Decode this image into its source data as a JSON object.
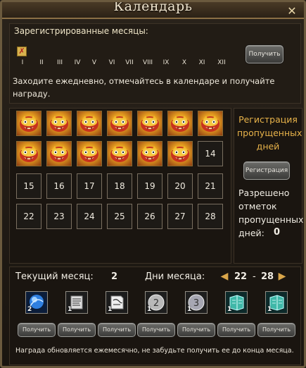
{
  "window": {
    "title": "Календарь",
    "close_glyph": "✕"
  },
  "top": {
    "registered_months_title": "Зарегистрированные месяцы:",
    "mark_icon": "calendar-mark-icon",
    "months": [
      "I",
      "II",
      "III",
      "IV",
      "V",
      "VI",
      "VII",
      "VIII",
      "IX",
      "X",
      "XI",
      "XII"
    ],
    "claim_label": "Получить",
    "info_text": "Заходите ежедневно, отмечайтесь в календаре и получайте награду."
  },
  "calendar": {
    "claimed_icon": "tiger-reward-icon",
    "days": [
      {
        "label": "",
        "claimed": true
      },
      {
        "label": "",
        "claimed": true
      },
      {
        "label": "",
        "claimed": true
      },
      {
        "label": "",
        "claimed": true
      },
      {
        "label": "",
        "claimed": true
      },
      {
        "label": "",
        "claimed": true
      },
      {
        "label": "",
        "claimed": true
      },
      {
        "label": "",
        "claimed": true
      },
      {
        "label": "",
        "claimed": true
      },
      {
        "label": "",
        "claimed": true
      },
      {
        "label": "",
        "claimed": true
      },
      {
        "label": "",
        "claimed": true
      },
      {
        "label": "",
        "claimed": true
      },
      {
        "label": "14",
        "claimed": false
      },
      {
        "label": "15",
        "claimed": false
      },
      {
        "label": "16",
        "claimed": false
      },
      {
        "label": "17",
        "claimed": false
      },
      {
        "label": "18",
        "claimed": false
      },
      {
        "label": "19",
        "claimed": false
      },
      {
        "label": "20",
        "claimed": false
      },
      {
        "label": "21",
        "claimed": false
      },
      {
        "label": "22",
        "claimed": false
      },
      {
        "label": "23",
        "claimed": false
      },
      {
        "label": "24",
        "claimed": false
      },
      {
        "label": "25",
        "claimed": false
      },
      {
        "label": "26",
        "claimed": false
      },
      {
        "label": "27",
        "claimed": false
      },
      {
        "label": "28",
        "claimed": false
      }
    ]
  },
  "side": {
    "missed_title": "Регистрация пропущенных дней",
    "register_label": "Регистрация",
    "allowed_text": "Разрешено отметок пропущенных дней:",
    "allowed_count": "0"
  },
  "bottom": {
    "current_month_label": "Текущий месяц:",
    "current_month_value": "2",
    "days_label": "Дни месяца:",
    "range_from": "22",
    "range_sep": "-",
    "range_to": "28",
    "arrow_left": "◀",
    "arrow_right": "▶",
    "rewards": [
      {
        "icon": "blue-orb-icon",
        "count": "2",
        "claim_label": "Получить"
      },
      {
        "icon": "scroll-icon",
        "count": "1",
        "claim_label": "Получить"
      },
      {
        "icon": "paper-note-icon",
        "count": "1",
        "claim_label": "Получить"
      },
      {
        "icon": "silver-coin-2-icon",
        "count": "1",
        "claim_label": "Получить"
      },
      {
        "icon": "silver-coin-3-icon",
        "count": "1",
        "claim_label": "Получить"
      },
      {
        "icon": "teal-book-icon",
        "count": "1",
        "claim_label": "Получить"
      },
      {
        "icon": "teal-book-icon",
        "count": "1",
        "claim_label": "Получить"
      }
    ],
    "footnote": "Награда обновляется ежемесячно, не забудьте получить ее до конца месяца."
  },
  "colors": {
    "accent_gold": "#e8b34a",
    "frame_brown": "#6b5a3e",
    "background": "#1a1510"
  }
}
